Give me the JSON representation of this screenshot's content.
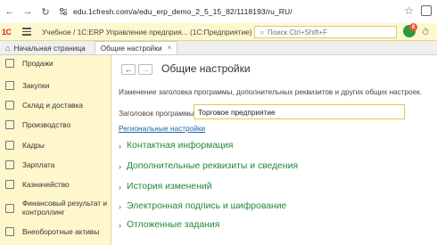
{
  "browser": {
    "url": "edu.1cfresh.com/a/edu_erp_demo_2_5_15_82/1118193/ru_RU/"
  },
  "header": {
    "logo": "1С",
    "title": "Учебное / 1С:ERP Управление предприя... (1С:Предприятие)",
    "search_placeholder": "Поиск Ctrl+Shift+F",
    "notification_count": "8"
  },
  "tabs": [
    {
      "label": "Начальная страница"
    },
    {
      "label": "Общие настройки"
    }
  ],
  "sidebar": {
    "items": [
      {
        "label": "Продажи"
      },
      {
        "label": "Закупки"
      },
      {
        "label": "Склад и доставка"
      },
      {
        "label": "Производство"
      },
      {
        "label": "Кадры"
      },
      {
        "label": "Зарплата"
      },
      {
        "label": "Казначейство"
      },
      {
        "label": "Финансовый результат и контроллинг"
      },
      {
        "label": "Внеоборотные активы"
      }
    ]
  },
  "main": {
    "title": "Общие настройки",
    "description": "Изменение заголовка программы, дополнительных реквизитов и других общих настроек.",
    "field_label": "Заголовок программы:",
    "field_value": "Торговое предприятие",
    "regional_link": "Региональные настройки",
    "sections": [
      {
        "label": "Контактная информация"
      },
      {
        "label": "Дополнительные реквизиты и сведения"
      },
      {
        "label": "История изменений"
      },
      {
        "label": "Электронная подпись и шифрование"
      },
      {
        "label": "Отложенные задания"
      }
    ]
  },
  "colors": {
    "sidebar_bg": "#fff7cc",
    "section_green": "#1f8a3a",
    "link_blue": "#1b64a8",
    "input_border": "#e6c84a"
  }
}
